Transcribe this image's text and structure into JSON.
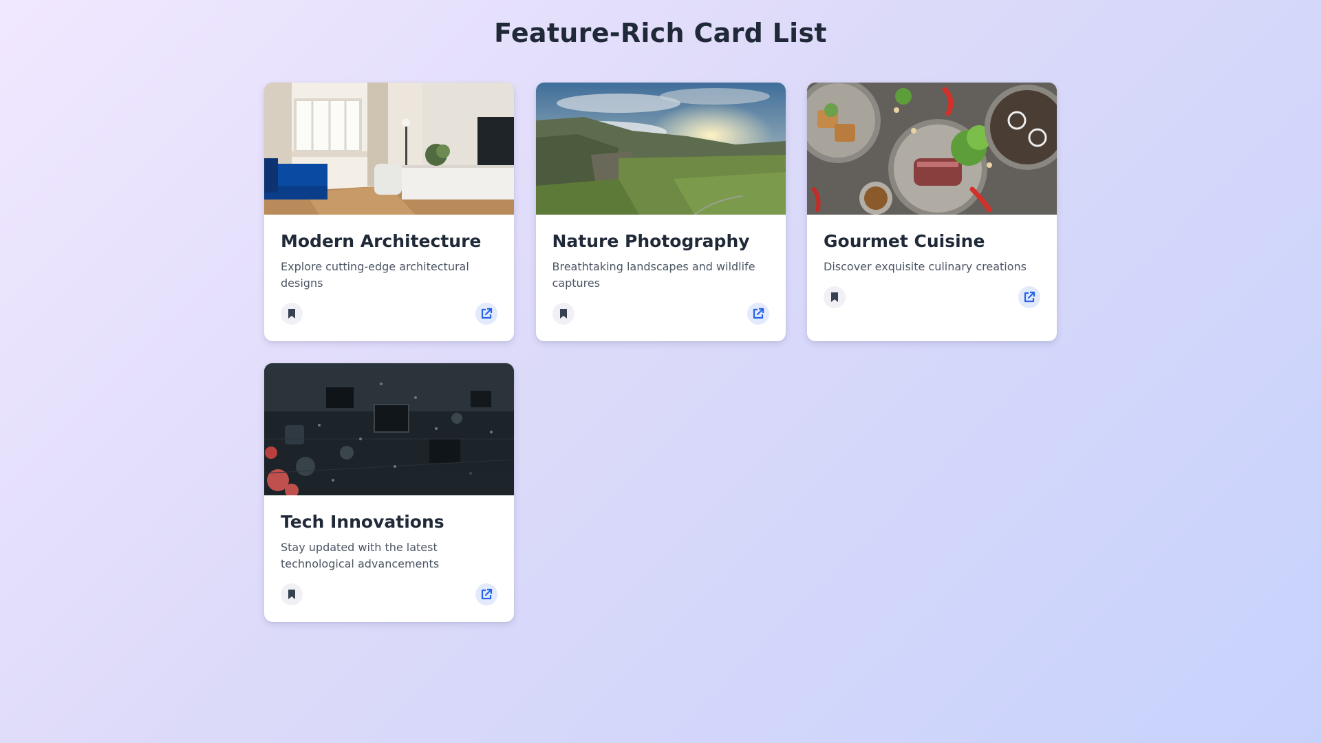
{
  "page": {
    "title": "Feature-Rich Card List"
  },
  "cards": [
    {
      "title": "Modern Architecture",
      "description": "Explore cutting-edge architectural designs",
      "image_icon": "living-room-photo",
      "bookmark_icon": "bookmark-icon",
      "open_icon": "external-link-icon"
    },
    {
      "title": "Nature Photography",
      "description": "Breathtaking landscapes and wildlife captures",
      "image_icon": "mountain-landscape-photo",
      "bookmark_icon": "bookmark-icon",
      "open_icon": "external-link-icon"
    },
    {
      "title": "Gourmet Cuisine",
      "description": "Discover exquisite culinary creations",
      "image_icon": "food-plates-photo",
      "bookmark_icon": "bookmark-icon",
      "open_icon": "external-link-icon"
    },
    {
      "title": "Tech Innovations",
      "description": "Stay updated with the latest technological advancements",
      "image_icon": "circuit-board-photo",
      "bookmark_icon": "bookmark-icon",
      "open_icon": "external-link-icon"
    }
  ],
  "colors": {
    "title": "#1f2937",
    "description": "#4b5563",
    "bookmark_icon": "#374151",
    "open_icon": "#2563eb",
    "bookmark_bg": "#f1f1f5",
    "open_bg": "#e3eafc"
  }
}
